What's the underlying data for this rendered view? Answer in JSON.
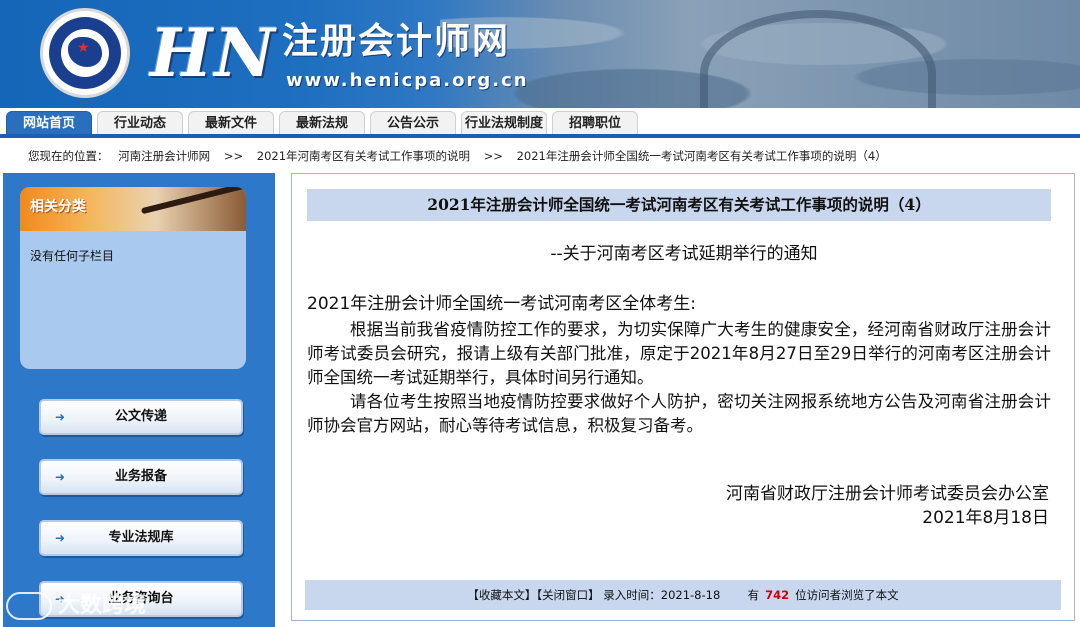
{
  "header": {
    "logo_text": "HN",
    "title": "注册会计师网",
    "url": "www.henicpa.org.cn"
  },
  "nav": {
    "tabs": [
      {
        "label": "网站首页"
      },
      {
        "label": "行业动态"
      },
      {
        "label": "最新文件"
      },
      {
        "label": "最新法规"
      },
      {
        "label": "公告公示"
      },
      {
        "label": "行业法规制度"
      },
      {
        "label": "招聘职位"
      }
    ]
  },
  "breadcrumb": {
    "prefix": "您现在的位置：",
    "items": [
      "河南注册会计师网",
      "2021年河南考区有关考试工作事项的说明",
      "2021年注册会计师全国统一考试河南考区有关考试工作事项的说明（4）"
    ],
    "separator": ">>"
  },
  "sidebar": {
    "category_title": "相关分类",
    "category_empty": "没有任何子栏目",
    "buttons": [
      {
        "label": "公文传递"
      },
      {
        "label": "业务报备"
      },
      {
        "label": "专业法规库"
      },
      {
        "label": "业务咨询台"
      }
    ]
  },
  "article": {
    "title": "2021年注册会计师全国统一考试河南考区有关考试工作事项的说明（4）",
    "subtitle": "--关于河南考区考试延期举行的通知",
    "greeting": "2021年注册会计师全国统一考试河南考区全体考生:",
    "paragraphs": [
      "根据当前我省疫情防控工作的要求，为切实保障广大考生的健康安全，经河南省财政厅注册会计师考试委员会研究，报请上级有关部门批准，原定于2021年8月27日至29日举行的河南考区注册会计师全国统一考试延期举行，具体时间另行通知。",
      "请各位考生按照当地疫情防控要求做好个人防护，密切关注网报系统地方公告及河南省注册会计师协会官方网站，耐心等待考试信息，积极复习备考。"
    ],
    "signature": "河南省财政厅注册会计师考试委员会办公室",
    "date": "2021年8月18日"
  },
  "footer": {
    "favorite": "【收藏本文】",
    "close": "【关闭窗口】",
    "entry_label": "录入时间：",
    "entry_date": "2021-8-18",
    "visit_prefix": "有",
    "visit_count": "742",
    "visit_suffix": "位访问者浏览了本文"
  },
  "watermark": {
    "text": "大数跨境"
  },
  "colors": {
    "nav_accent": "#1a5fb4",
    "sidebar_bg": "#2e78c9",
    "title_bar": "#c8d6ee",
    "visit_count": "#cc0000"
  }
}
